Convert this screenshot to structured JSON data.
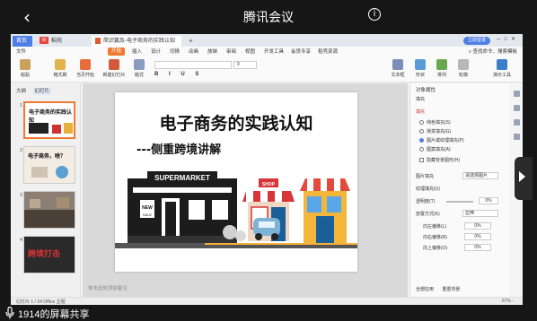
{
  "app": {
    "title": "腾讯会议"
  },
  "share_label": "1914的屏幕共享",
  "wps": {
    "tabs": {
      "home": "首页",
      "wps": "稻壳",
      "doc": "简识篇及-电子商务的实践认知"
    },
    "login": "立即登录",
    "menu": [
      "文件",
      "开始",
      "插入",
      "设计",
      "切换",
      "动画",
      "放映",
      "审阅",
      "视图",
      "开发工具",
      "会员专享",
      "稻壳资源"
    ],
    "menu_active": "开始",
    "menu_right": "查找命令、搜索模板",
    "ribbon": {
      "paste": "粘贴",
      "format_painter": "格式刷",
      "from_current": "当页开始",
      "new_slide": "新建幻灯片",
      "layout": "版式",
      "section": "节",
      "reset": "重置",
      "font_name": "",
      "font_size": "0",
      "text_box": "文本框",
      "shapes": "形状",
      "arrange": "排列",
      "outline": "轮廓",
      "presenter": "演示工具"
    },
    "leftpane": {
      "tab_outline": "大纲",
      "tab_slides": "幻灯片",
      "thumbs": [
        {
          "num": "1",
          "title": "电子商务的实践认知"
        },
        {
          "num": "2",
          "title": "电子商务，啥？"
        },
        {
          "num": "3",
          "title": ""
        },
        {
          "num": "4",
          "title": "跨境打击"
        }
      ]
    },
    "slide": {
      "title": "电子商务的实践认知",
      "subtitle": "---侧重跨境讲解",
      "shop_signs": {
        "supermarket": "SUPERMARKET",
        "shop": "SHOP",
        "new": "NEW",
        "sale": "SALE"
      }
    },
    "note_placeholder": "单击此处添加备注",
    "rightpane": {
      "title": "对象属性",
      "section": "填充",
      "fill_header": "填充",
      "options": [
        {
          "label": "纯色填充(S)",
          "on": false
        },
        {
          "label": "渐变填充(G)",
          "on": false
        },
        {
          "label": "图片或纹理填充(P)",
          "on": true
        },
        {
          "label": "图案填充(A)",
          "on": false
        }
      ],
      "hide_bg": "隐藏背景图形(H)",
      "pic_fill": "图片填充",
      "pic_fill_val": "请选择图片",
      "texture": "纹理填充(U)",
      "transparency": "透明度(T)",
      "transparency_val": "0%",
      "placement": "放置方式(K)",
      "placement_val": "拉伸",
      "left_offset": "向左偏移(L)",
      "right_offset": "向右偏移(R)",
      "up_offset": "向上偏移(O)",
      "offset_val": "0%",
      "apply_all": "全部应用",
      "reset_bg": "重置背景"
    },
    "status": {
      "left": "幻灯片 1 / 24   Office 主题",
      "right": "67% -"
    }
  }
}
